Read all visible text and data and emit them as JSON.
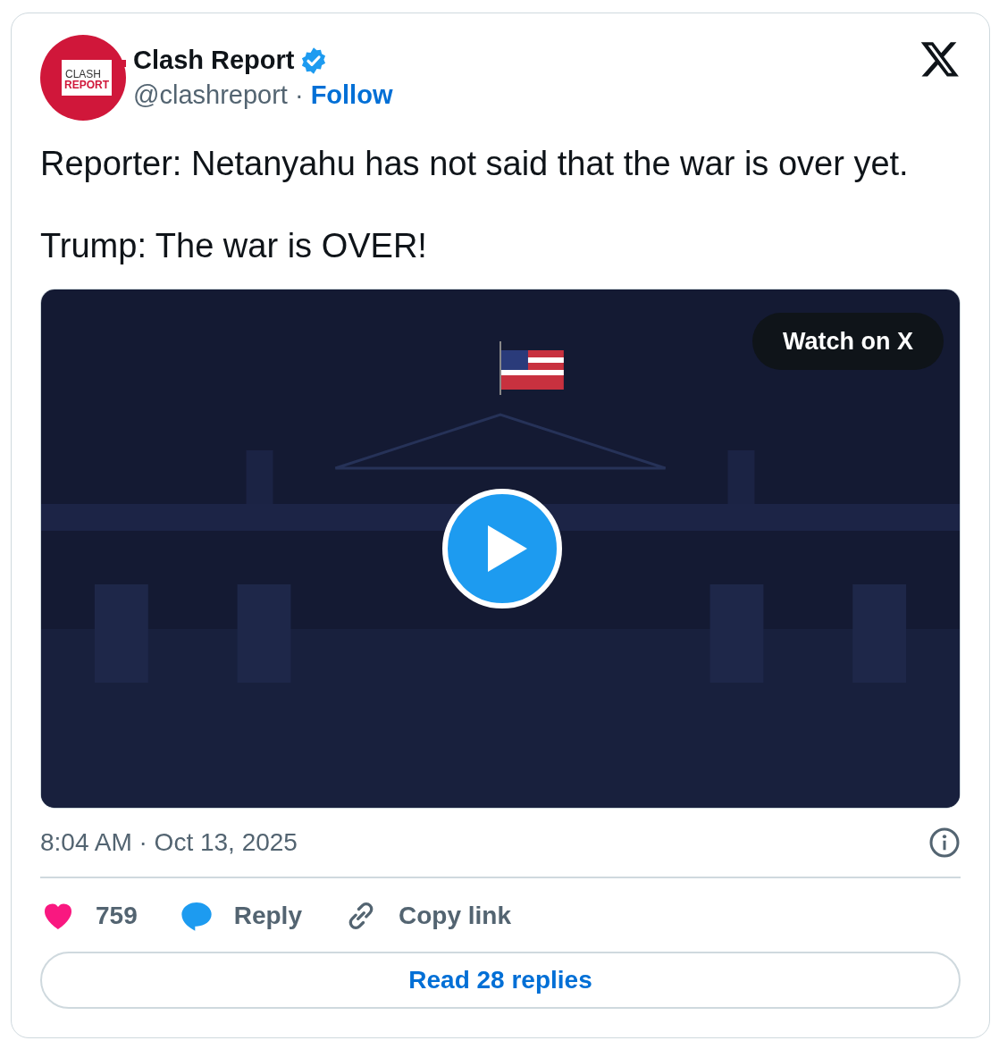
{
  "author": {
    "name": "Clash Report",
    "verified": true,
    "handle": "@clashreport",
    "separator": "·",
    "follow": "Follow",
    "avatar_text": [
      "CLASH",
      "REPORT"
    ]
  },
  "text": [
    "Reporter: Netanyahu has not said that the war is over yet.",
    "Trump: The war is OVER!"
  ],
  "media": {
    "kind": "picture",
    "watch_label": "Watch on X"
  },
  "timestamp": "8:04 AM · Oct 13, 2025",
  "actions": [
    {
      "kind": "like",
      "label": "759"
    },
    {
      "kind": "reply",
      "label": "Reply"
    },
    {
      "kind": "link",
      "label": "Copy link"
    }
  ],
  "read_button": "Read 28 replies"
}
